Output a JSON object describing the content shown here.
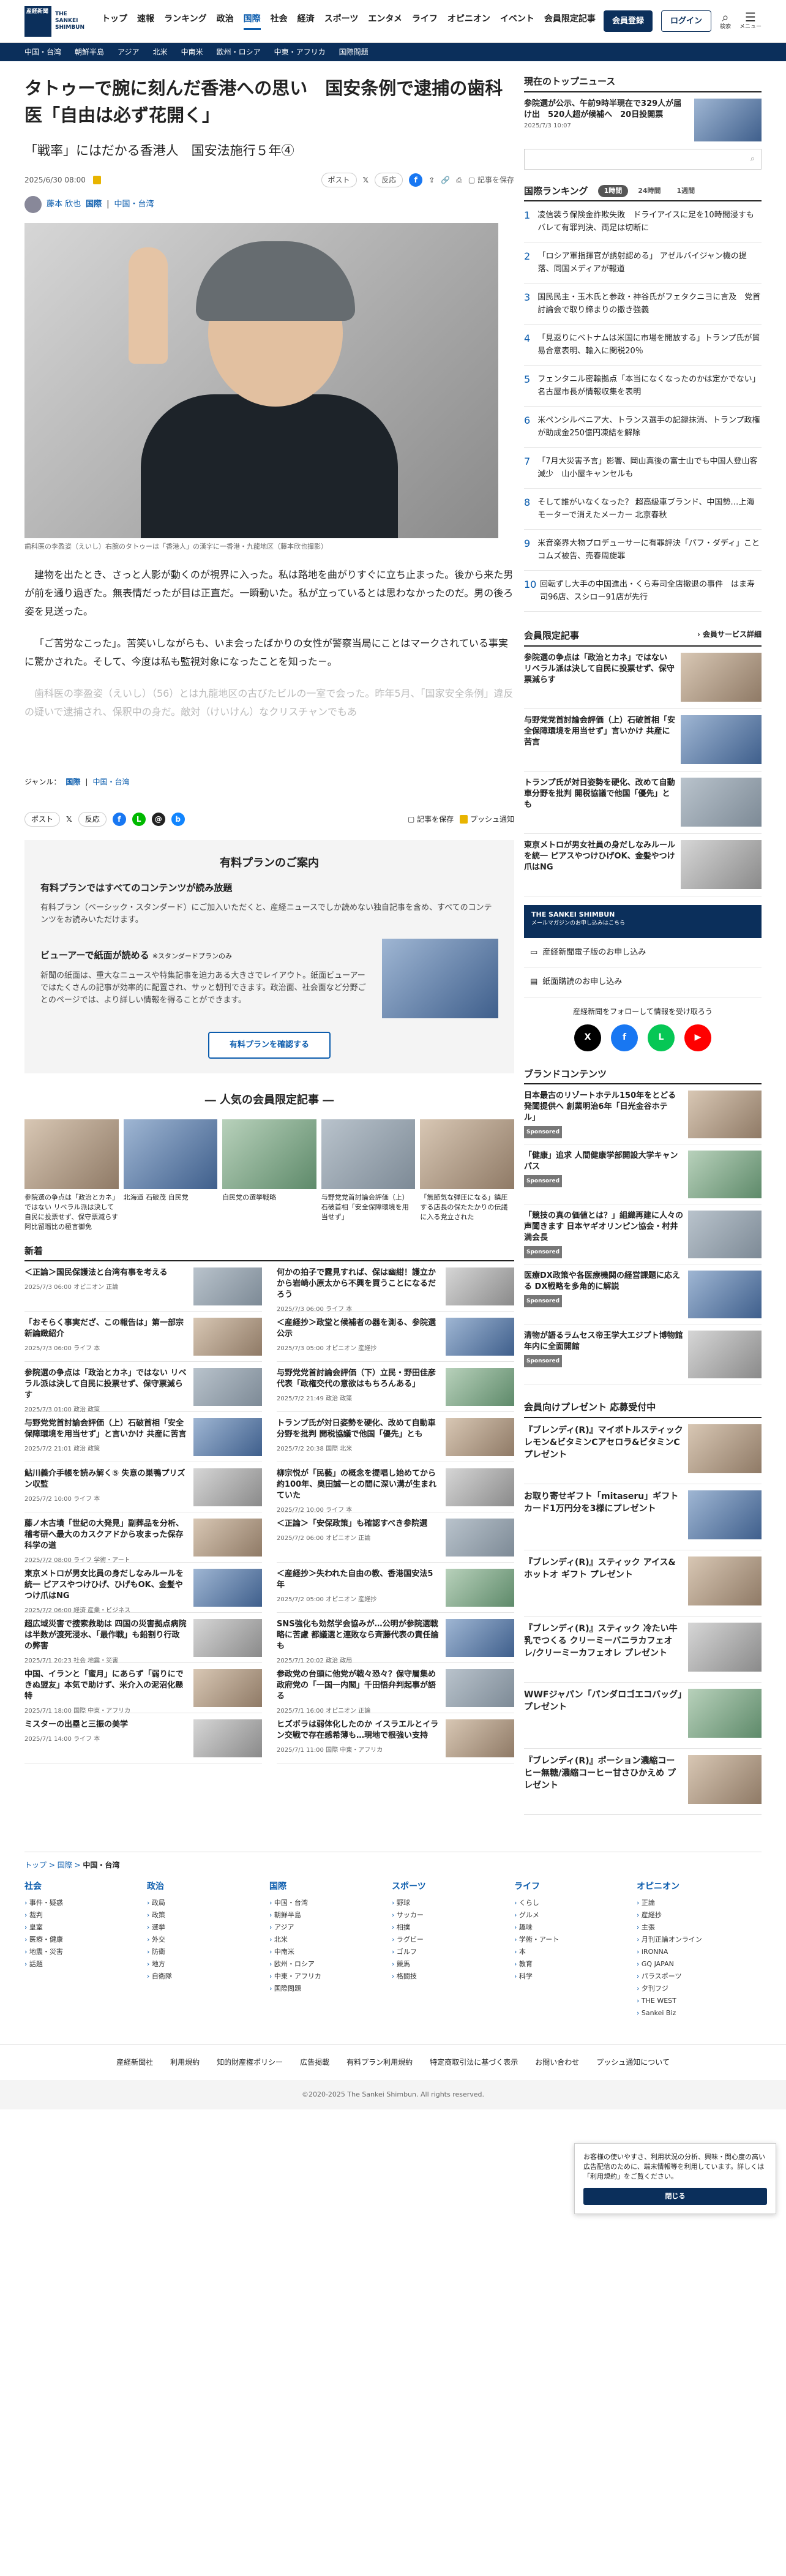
{
  "header": {
    "logo_jp": "産経新聞",
    "logo_en": "THE SANKEI SHIMBUN",
    "nav": [
      "トップ",
      "速報",
      "ランキング",
      "政治",
      "国際",
      "社会",
      "経済",
      "スポーツ",
      "エンタメ",
      "ライフ",
      "オピニオン",
      "イベント",
      "会員限定記事"
    ],
    "member_btn": "会員登録",
    "login_btn": "ログイン",
    "search_label": "検索",
    "menu_label": "メニュー"
  },
  "subnav": [
    "中国・台湾",
    "朝鮮半島",
    "アジア",
    "北米",
    "中南米",
    "欧州・ロシア",
    "中東・アフリカ",
    "国際問題"
  ],
  "article": {
    "title": "タトゥーで腕に刻んだ香港への思い　国安条例で逮捕の歯科医「自由は必ず花開く」",
    "subtitle": "「戦率」にはだかる香港人　国安法施行５年④",
    "date": "2025/6/30 08:00",
    "post_btn": "ポスト",
    "like_btn": "反応",
    "save_label": "記事を保存",
    "author": "藤本 欣也",
    "section": "国際",
    "category": "中国・台湾",
    "caption": "歯科医の李盈姿（えいし）右腕のタトゥーは「香港人」の漢字に一香港・九龍地区（藤本欣也撮影）",
    "para1": "建物を出たとき、さっと人影が動くのが視界に入った。私は路地を曲がりすぐに立ち止まった。後から来た男が前を通り過ぎた。無表情だったが目は正直だ。一瞬動いた。私が立っているとは思わなかったのだ。男の後ろ姿を見送った。",
    "para2": "「ご苦労なこった」。苦笑いしながらも、いま会ったばかりの女性が警察当局にことはマークされている事実に驚かされた。そして、今度は私も監視対象になったことを知った－。",
    "para3": "歯科医の李盈姿（えいし）（56）とは九龍地区の古びたビルの一室で会った。昨年5月、「国家安全条例」違反の疑いで逮捕され、保釈中の身だ。敵対（けいけん）なクリスチャンでもあ",
    "genre_label": "ジャンル：",
    "genre1": "国際",
    "genre2": "中国・台湾",
    "push_label": "プッシュ通知"
  },
  "paywall": {
    "title": "有料プランのご案内",
    "h1": "有料プランではすべてのコンテンツが読み放題",
    "p1": "有料プラン（ベーシック・スタンダード）にご加入いただくと、産経ニュースでしか読めない独自記事を含め、すべてのコンテンツをお読みいただけます。",
    "h2": "ビューアーで紙面が読める",
    "h2_note": "※スタンダードプランのみ",
    "p2": "新聞の紙面は、重大なニュースや特集記事を迫力ある大きさでレイアウト。紙面ビューアーではたくさんの記事が効率的に配置され、サッと朝刊できます。政治面、社会面など分野ごとのページでは、より詳しい情報を得ることができます。",
    "btn": "有料プランを確認する"
  },
  "popular": {
    "title": "人気の会員限定記事",
    "items": [
      "参院選の争点は「政治とカネ」ではない リベラル派は決して自民に投票せず、保守票減らす 阿比留瑠比の極言御免",
      "北海道 石破茂 自民党",
      "自民党の選挙戦略",
      "与野党党首討論会評価（上）石破首相「安全保障環境を用当せず」",
      "「無節気な弾圧になる」鎮圧する店長の保たたかりの伝議に入る党立された"
    ]
  },
  "news": {
    "title": "新着",
    "items": [
      {
        "t": "＜正論＞国民保護法と台湾有事を考える",
        "d": "2025/7/3 06:00",
        "c": "オピニオン 正論"
      },
      {
        "t": "何かの拍子で露見すれば、保は幽紺！護立かから岩崎小原太から不興を買うことになるだろう",
        "d": "2025/7/3 06:00",
        "c": "ライフ 本"
      },
      {
        "t": "「おそらく事実だざ、この報告は」第一部宗新論緻紹介",
        "d": "2025/7/3 06:00",
        "c": "ライフ 本"
      },
      {
        "t": "＜産経抄＞政堂と候補者の器を測る、参院選公示",
        "d": "2025/7/3 05:00",
        "c": "オピニオン 産経抄"
      },
      {
        "t": "参院選の争点は「政治とカネ」ではない リベラル派は決して自民に投票せず、保守票減らす",
        "d": "2025/7/3 01:00",
        "c": "政治 政策"
      },
      {
        "t": "与野党党首討論会評価（下）立民・野田佳彦代表「政権交代の意欲はもちろんある」",
        "d": "2025/7/2 21:49",
        "c": "政治 政策"
      },
      {
        "t": "与野党党首討論会評価（上）石破首相「安全保障環境を用当せず」と言いかけ 共産に苦言",
        "d": "2025/7/2 21:01",
        "c": "政治 政策"
      },
      {
        "t": "トランプ氏が対日姿勢を硬化、改めて自動車分野を批判 開税協議で他国「優先」とも",
        "d": "2025/7/2 20:38",
        "c": "国際 北米"
      },
      {
        "t": "鮎川義介手帳を読み解く⑤ 失意の巣鴨プリズン収監",
        "d": "2025/7/2 10:00",
        "c": "ライフ 本"
      },
      {
        "t": "柳宗悦が「民藝」の概念を提唱し始めてから約100年、奥田誠一との間に深い溝が生まれていた",
        "d": "2025/7/2 10:00",
        "c": "ライフ 本"
      },
      {
        "t": "藤ノ木古墳「世紀の大発見」副葬品を分析、稽考研へ最大のカスクアドから攻まった保存科学の道",
        "d": "2025/7/2 08:00",
        "c": "ライフ 学術・アート"
      },
      {
        "t": "＜正論＞「安保政策」も確認すべき参院選",
        "d": "2025/7/2 06:00",
        "c": "オピニオン 正論"
      },
      {
        "t": "東京メトロが男女比員の身だしなみルールを統一 ピアスやつけひげ、ひげもOK、金髪やつけ爪はNG",
        "d": "2025/7/2 06:00",
        "c": "経済 産業・ビジネス"
      },
      {
        "t": "＜産経抄＞失われた自由の教、香港国安法5年",
        "d": "2025/7/2 05:00",
        "c": "オピニオン 産経抄"
      },
      {
        "t": "超広域災害で捜索救助は 四国の災害拠点病院は半数が渡死浸水、「最作戦」も鉛割り行政の弊害",
        "d": "2025/7/1 20:23",
        "c": "社会 地震・災害"
      },
      {
        "t": "SNS強化も効然学会協みが…公明が参院選戦略に苦慮 都議選と連敗なら斉藤代表の責任論も",
        "d": "2025/7/1 20:02",
        "c": "政治 政局"
      },
      {
        "t": "中国、イランと「蜜月」にあらず「弱りにできぬ盟友」本気で助けず、米介入の泥沼化懸特",
        "d": "2025/7/1 18:00",
        "c": "国際 中東・アフリカ"
      },
      {
        "t": "参政党の台頭に他党が戦々恐々？保守層集め 政府党の「一国一内閣」千田悟弁判起事が語る",
        "d": "2025/7/1 16:00",
        "c": "オピニオン 正論"
      },
      {
        "t": "ミスターの出塁と三振の美学",
        "d": "2025/7/1 14:00",
        "c": "ライフ 本"
      },
      {
        "t": "ヒズボラは弱体化したのか イスラエルとイラン交戦で存在感希薄も…現地で根強い支持",
        "d": "2025/7/1 11:00",
        "c": "国際 中東・アフリカ"
      }
    ]
  },
  "side": {
    "top_title": "現在のトップニュース",
    "top_item": "参院選が公示、午前9時半現在で329人が届け出　520人超が候補へ　20日投開票",
    "top_date": "2025/7/3 10:07",
    "search_placeholder": "",
    "rank_title": "国際ランキング",
    "rank_tabs": [
      "1時間",
      "24時間",
      "1週間"
    ],
    "ranks": [
      "凌信装う保険金詐欺失敗　ドライアイスに足を10時間浸すもバレて有罪判決、両足は切断に",
      "「ロシア軍指揮官が誘射認める」 アゼルバイジャン機の提落、同国メディアが報道",
      "国民民主・玉木氏と参政・神谷氏がフェタクニヨに言及　党首討論会で取り締まりの撤き強義",
      "「見返りにベトナムは米国に市場を開放する」トランプ氏が貿易合意表明、輸入に関税20％",
      "フェンタニル密輸拠点「本当になくなったのかは定かでない」名古屋市長が情報収集を表明",
      "米ペンシルベニア大、トランス選手の記録抹消、トランプ政権が助成金250億円凍結を解除",
      "「7月大災害予言」影響、岡山真後の富士山でも中国人登山客減少　山小屋キャンセルも",
      "そして誰がいなくなった？ 超高級車ブランド、中国勢…上海モーターで消えたメーカー 北京春秋",
      "米音楽界大物プロデューサーに有罪評決「パフ・ダディ」ことコムズ被告、売春周旋罪",
      "回転ずし大手の中国進出・くら寿司全店撤退の事件　はま寿司96店、スシロー91店が先行"
    ],
    "mem_title": "会員限定記事",
    "mem_more": "会員サービス詳細",
    "mem_items": [
      "参院選の争点は「政治とカネ」ではない リベラル派は決して自民に投票せず、保守票減らす",
      "与野党党首討論会評価（上）石破首相「安全保障環境を用当せず」言いかけ 共産に苦言",
      "トランプ氏が対日姿勢を硬化、改めて自動車分野を批判 開税協議で他国「優先」とも",
      "東京メトロが男女社員の身だしなみルールを統一 ピアスやつけひげOK、金髪やつけ爪はNG"
    ],
    "banner_title": "THE SANKEI SHIMBUN",
    "banner_sub": "メールマガジンのお申し込みはこちら",
    "link1": "産経新聞電子版のお申し込み",
    "link2": "紙面購読のお申し込み",
    "follow": "産経新聞をフォローして情報を受け取ろう",
    "brand_title": "ブランドコンテンツ",
    "brands": [
      "日本最古のリゾートホテル150年をとどる発聞提供へ 創業明治6年「日光金谷ホテル」",
      "「健康」追求 人間健康学部開設大学キャンパス",
      "「競技の真の価値とは？」組織再建に人々の声聞きます 日本ヤギオリンピン協会・村井満会長",
      "医療DX政策や各医療機関の経営課題に応える DX戦略を多角的に解説",
      "清物が語るラムセス帝王学大エジプト博物館 年内に全面開館"
    ],
    "sponsored": "Sponsored",
    "present_title": "会員向けプレゼント 応募受付中",
    "presents": [
      "『ブレンディ(R)』マイボトルスティック レモン&ビタミンCアセロラ&ビタミンC プレゼント",
      "お取り寄せギフト「mitaseru」ギフトカード1万円分を3様にプレゼント",
      "『ブレンディ(R)』スティック アイス&ホットオ ギフト プレゼント",
      "『ブレンディ(R)』スティック 冷たい牛乳でつくる クリーミーバニラカフェオレ/クリーミーカフェオレ プレゼント",
      "WWFジャパン「パンダロゴエコバッグ」プレゼント",
      "『ブレンディ(R)』ポーション濃縮コーヒー無糖/濃縮コーヒー甘さひかえめ プレゼント"
    ]
  },
  "breadcrumb": [
    "トップ",
    "国際",
    "中国・台湾"
  ],
  "footer": {
    "cols": [
      {
        "h": "社会",
        "items": [
          "事件・疑惑",
          "裁判",
          "皇室",
          "医療・健康",
          "地震・災害",
          "話題"
        ]
      },
      {
        "h": "政治",
        "items": [
          "政局",
          "政策",
          "選挙",
          "外交",
          "防衛",
          "地方",
          "自衛隊"
        ]
      },
      {
        "h": "国際",
        "items": [
          "中国・台湾",
          "朝鮮半島",
          "アジア",
          "北米",
          "中南米",
          "欧州・ロシア",
          "中東・アフリカ",
          "国際問題"
        ]
      },
      {
        "h": "スポーツ",
        "items": [
          "野球",
          "サッカー",
          "相撲",
          "ラグビー",
          "ゴルフ",
          "競馬",
          "格闘技"
        ]
      },
      {
        "h": "ライフ",
        "items": [
          "くらし",
          "グルメ",
          "趣味",
          "学術・アート",
          "本",
          "教育",
          "科学"
        ]
      },
      {
        "h": "オピニオン",
        "items": [
          "正論",
          "産経抄",
          "主張",
          "月刊正論オンライン",
          "iRONNA",
          "GQ JAPAN",
          "パラスポーツ",
          "夕刊フジ",
          "THE WEST",
          "Sankei Biz"
        ]
      }
    ],
    "links": [
      "産経新聞社",
      "利用規約",
      "知的財産権ポリシー",
      "広告掲載",
      "有料プラン利用規約",
      "特定商取引法に基づく表示",
      "お問い合わせ",
      "プッシュ通知について"
    ],
    "copyright": "©2020-2025 The Sankei Shimbun. All rights reserved."
  },
  "cookie": {
    "text": "お客様の使いやすさ、利用状況の分析、興味・関心度の高い広告配信のために、端末情報等を利用しています。詳しくは「利用規約」をご覧ください。",
    "btn": "閉じる"
  }
}
